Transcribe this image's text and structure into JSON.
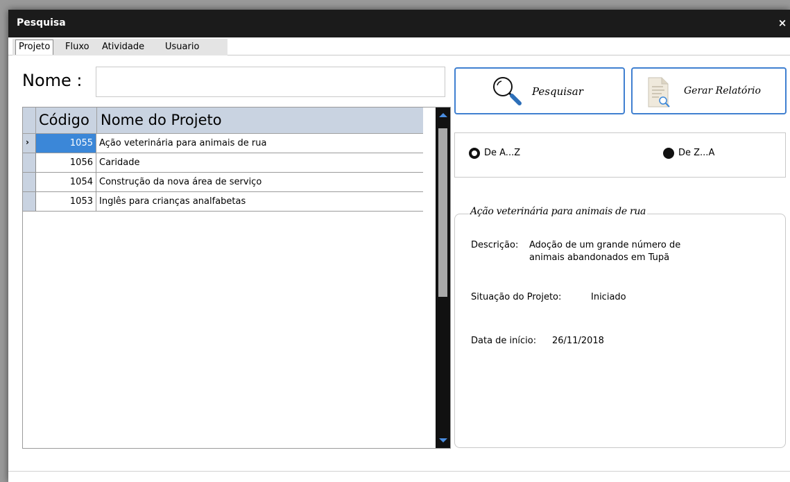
{
  "window": {
    "title": "Pesquisa",
    "close_icon": "×"
  },
  "tabs": [
    {
      "label": "Projeto",
      "active": true
    },
    {
      "label": "Fluxo",
      "active": false
    },
    {
      "label": "Atividade",
      "active": false
    },
    {
      "label": "Usuario",
      "active": false
    }
  ],
  "search": {
    "label": "Nome :",
    "value": "",
    "placeholder": ""
  },
  "grid": {
    "columns": [
      "Código",
      "Nome do Projeto"
    ],
    "rows": [
      {
        "code": "1055",
        "name": "Ação veterinária para animais de rua",
        "selected": true
      },
      {
        "code": "1056",
        "name": "Caridade",
        "selected": false
      },
      {
        "code": "1054",
        "name": "Construção da nova área de serviço",
        "selected": false
      },
      {
        "code": "1053",
        "name": "Inglês para crianças analfabetas",
        "selected": false
      }
    ],
    "row_pointer": "›"
  },
  "buttons": {
    "search_label": "Pesquisar",
    "report_label": "Gerar Relatório"
  },
  "sort": {
    "asc_label": "De A...Z",
    "desc_label": "De Z...A",
    "selected": "asc"
  },
  "details": {
    "title": "Ação veterinária para animais de rua",
    "description_label": "Descrição:",
    "description_line1": "Adoção de um grande número de",
    "description_line2": "animais abandonados em Tupã",
    "status_label": "Situação do Projeto:",
    "status_value": "Iniciado",
    "date_label": "Data de início:",
    "date_value": "26/11/2018"
  },
  "colors": {
    "accent": "#3f7fd0",
    "selection": "#3b87d8",
    "header_bg": "#c9d3e1",
    "titlebar": "#1b1b1b"
  }
}
